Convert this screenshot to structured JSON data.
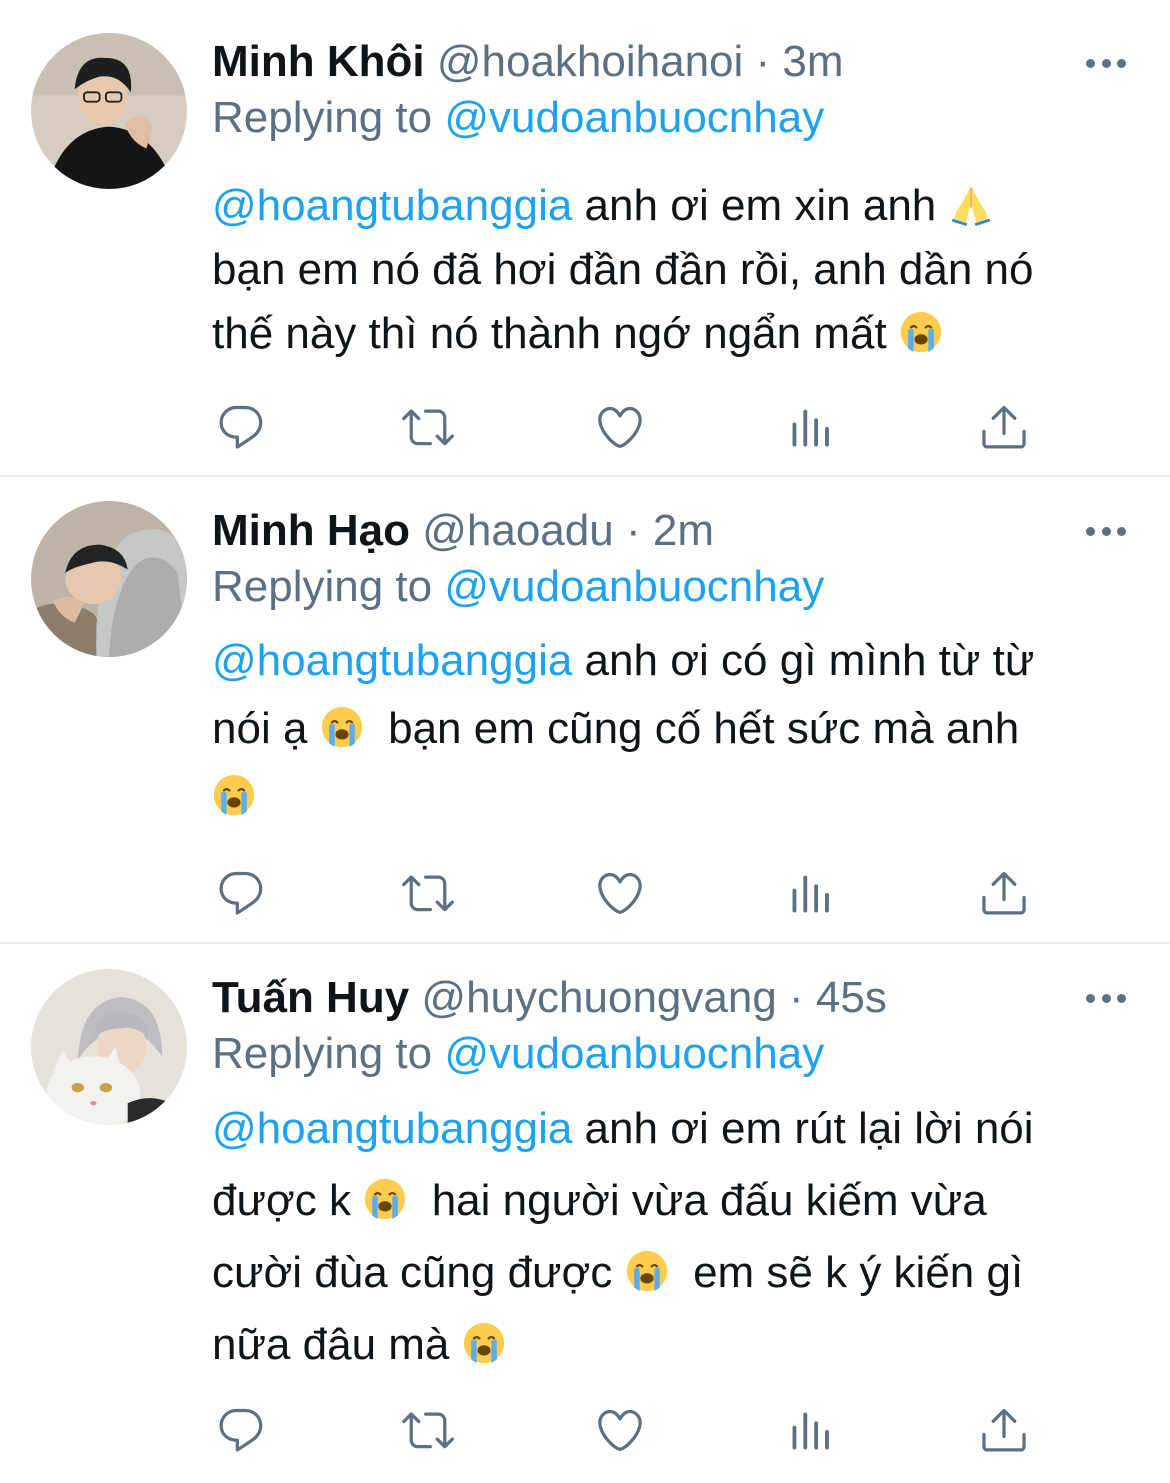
{
  "tweets": [
    {
      "name": "Minh Khôi",
      "handle": "@hoakhoihanoi",
      "separator": "·",
      "time": "3m",
      "replying_label": "Replying to",
      "replying_handle": "@vudoanbuocnhay",
      "mention": "@hoangtubanggia",
      "lines": [
        " anh ơi em xin anh",
        "bạn em nó đã hơi đần đần rồi, anh dần nó",
        "thế này thì nó thành ngớ ngẩn mất"
      ],
      "emojis": [
        "folded-hands",
        "loudly-crying-face"
      ]
    },
    {
      "name": "Minh Hạo",
      "handle": "@haoadu",
      "separator": "·",
      "time": "2m",
      "replying_label": "Replying to",
      "replying_handle": "@vudoanbuocnhay",
      "mention": "@hoangtubanggia",
      "lines": [
        " anh ơi có gì mình từ từ",
        "nói ạ",
        "bạn em cũng cố hết sức mà anh"
      ],
      "emojis": [
        "loudly-crying-face",
        "loudly-crying-face"
      ]
    },
    {
      "name": "Tuấn Huy",
      "handle": "@huychuongvang",
      "separator": "·",
      "time": "45s",
      "replying_label": "Replying to",
      "replying_handle": "@vudoanbuocnhay",
      "mention": "@hoangtubanggia",
      "lines": [
        " anh ơi em rút lại lời nói",
        "được k",
        "hai người vừa đấu kiếm vừa",
        "cười đùa cũng được",
        "em sẽ k ý kiến gì",
        "nữa đâu mà"
      ],
      "emojis": [
        "loudly-crying-face",
        "loudly-crying-face",
        "loudly-crying-face"
      ]
    }
  ],
  "action_icons": [
    "reply-icon",
    "retweet-icon",
    "like-icon",
    "analytics-icon",
    "share-icon"
  ],
  "colors": {
    "link": "#1da1f2",
    "secondary_text": "#5b7083",
    "primary_text": "#0f1419",
    "divider": "#e6ecf0"
  }
}
